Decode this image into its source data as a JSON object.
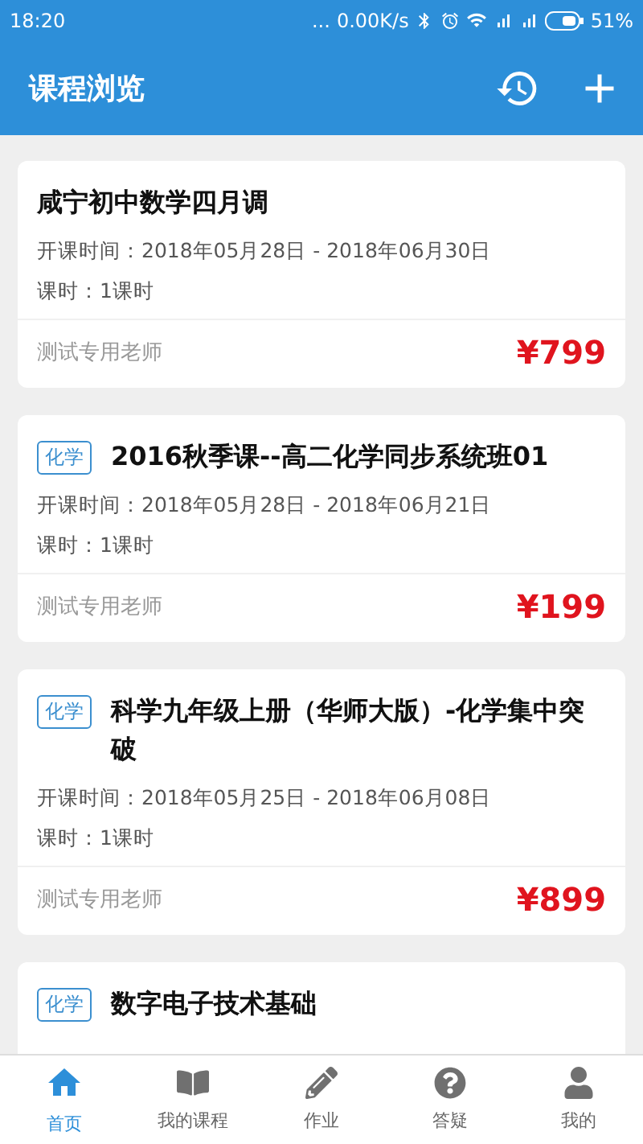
{
  "status_bar": {
    "time": "18:20",
    "dots": "...",
    "speed": "0.00K/s",
    "battery": "51%"
  },
  "app_bar": {
    "title": "课程浏览"
  },
  "courses": [
    {
      "title": "咸宁初中数学四月调",
      "dates": "开课时间：2018年05月28日 - 2018年06月30日",
      "hours": "课时：1课时",
      "teacher": "测试专用老师",
      "price": "¥799"
    },
    {
      "tag": "化学",
      "title": "2016秋季课--高二化学同步系统班01",
      "dates": "开课时间：2018年05月28日 - 2018年06月21日",
      "hours": "课时：1课时",
      "teacher": "测试专用老师",
      "price": "¥199"
    },
    {
      "tag": "化学",
      "title": "科学九年级上册（华师大版）-化学集中突破",
      "dates": "开课时间：2018年05月25日 - 2018年06月08日",
      "hours": "课时：1课时",
      "teacher": "测试专用老师",
      "price": "¥899"
    },
    {
      "tag": "化学",
      "title": "数字电子技术基础"
    }
  ],
  "tabs": [
    {
      "kind": "home",
      "label": "首页",
      "selected": true
    },
    {
      "kind": "book",
      "label": "我的课程",
      "selected": false
    },
    {
      "kind": "pencil",
      "label": "作业",
      "selected": false
    },
    {
      "kind": "question",
      "label": "答疑",
      "selected": false
    },
    {
      "kind": "user",
      "label": "我的",
      "selected": false
    }
  ]
}
